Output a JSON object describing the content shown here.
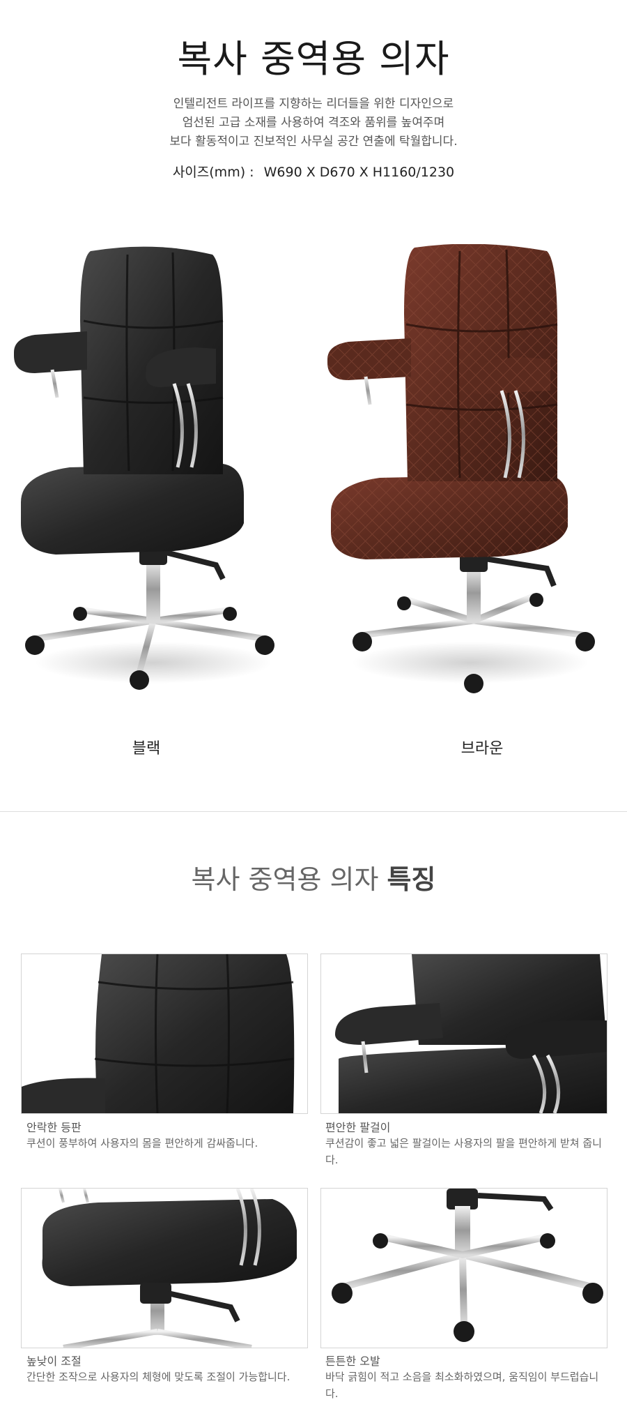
{
  "header": {
    "title": "복사 중역용 의자",
    "description": [
      "인텔리전트 라이프를 지향하는 리더들을 위한 디자인으로",
      "엄선된 고급 소재를 사용하여 격조와 품위를 높여주며",
      "보다 활동적이고 진보적인 사무실 공간 연출에 탁월합니다."
    ],
    "size_label": "사이즈(mm) :",
    "size_value": "W690 X D670 X H1160/1230"
  },
  "variants": [
    {
      "label": "블랙",
      "color": "#2a2a2a"
    },
    {
      "label": "브라운",
      "color": "#5a2a1e"
    }
  ],
  "features": {
    "title_prefix": "복사 중역용 의자",
    "title_bold": "특징",
    "items": [
      {
        "title": "안락한 등판",
        "text": "쿠션이 풍부하여 사용자의 몸을 편안하게  감싸줍니다."
      },
      {
        "title": "편안한 팔걸이",
        "text": "쿠션감이 좋고 넓은 팔걸이는 사용자의 팔을 편안하게 받쳐 줍니다."
      },
      {
        "title": "높낮이 조절",
        "text": "간단한 조작으로 사용자의 체형에 맞도록 조절이 가능합니다."
      },
      {
        "title": "튼튼한 오발",
        "text": "바닥 긁힘이 적고 소음을 최소화하였으며, 움직임이 부드럽습니다."
      }
    ]
  }
}
